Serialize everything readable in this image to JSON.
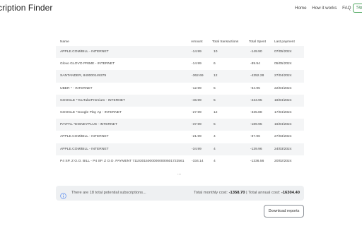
{
  "header": {
    "brand": "cription Finder",
    "nav": [
      "Home",
      "How it works",
      "FAQ"
    ],
    "signin_label": "Sig"
  },
  "table": {
    "columns": [
      "Name",
      "Amount",
      "Total transactions",
      "Total Spent",
      "Last payment"
    ],
    "rows": [
      [
        "APPLE.COM/BILL - INTERNET",
        "-14.99",
        "10",
        "-149.90",
        "07/05/2024"
      ],
      [
        "Glovo GLOVO PRIME - INTERNET",
        "-14.99",
        "6",
        "-89.94",
        "05/05/2024"
      ],
      [
        "SANTANDER, 840000149379",
        "-362.69",
        "12",
        "-4352.28",
        "27/04/2024"
      ],
      [
        "UBER * - INTERNET",
        "-12.99",
        "5",
        "-64.95",
        "22/04/2024"
      ],
      [
        "GOOGLE *YouTubePremium - INTERNET",
        "-46.99",
        "5",
        "-234.95",
        "18/04/2024"
      ],
      [
        "GOOGLE *Google Play Ap - INTERNET",
        "-27.99",
        "12",
        "-335.88",
        "17/04/2024"
      ],
      [
        "PAYPAL *DISNEYPLUS - INTERNET",
        "-37.99",
        "5",
        "-189.95",
        "16/04/2024"
      ],
      [
        "APPLE.COM/BILL - INTERNET",
        "-21.99",
        "4",
        "-87.96",
        "27/03/2024"
      ],
      [
        "APPLE.COM/BILL - INTERNET",
        "-34.99",
        "4",
        "-139.96",
        "24/03/2024"
      ],
      [
        "P4 SP. Z O.O. BILL - P4 SP. Z O.O. PAYMENT 711030150000000000501722561",
        "-334.14",
        "4",
        "-1336.56",
        "20/02/2024"
      ]
    ]
  },
  "ellipsis": "...",
  "summary": {
    "icon": "info-icon",
    "count_text": "There are 18 total potential subscriptions...",
    "monthly_label": "Total monthly cost:",
    "monthly_value": "-1358.70",
    "separator": "|",
    "annual_label": "Total annual cost:",
    "annual_value": "-16304.40"
  },
  "actions": {
    "download_label": "Download reports"
  },
  "colors": {
    "accent_green": "#4ea85f",
    "info_blue": "#5b8def",
    "row_stripe": "#f4f5f6",
    "summary_bg": "#eef0f2"
  }
}
